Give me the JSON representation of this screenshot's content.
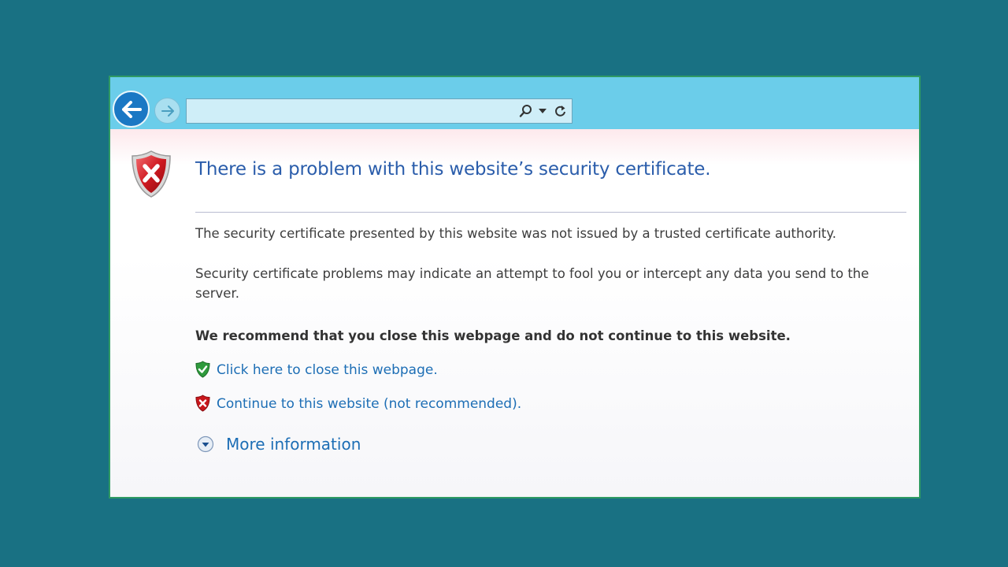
{
  "toolbar": {
    "back_icon": "back-arrow-icon",
    "forward_icon": "forward-arrow-icon",
    "address_value": "",
    "address_icons": [
      "search-icon",
      "dropdown-icon",
      "refresh-icon"
    ]
  },
  "page": {
    "title": "There is a problem with this website’s security certificate.",
    "paragraph_1": "The security certificate presented by this website was not issued by a trusted certificate authority.",
    "paragraph_2": "Security certificate problems may indicate an attempt to fool you or intercept any data you send to the server.",
    "recommendation": "We recommend that you close this webpage and do not continue to this website.",
    "close_link": "Click here to close this webpage.",
    "continue_link": "Continue to this website (not recommended).",
    "more_info": "More information"
  },
  "colors": {
    "background": "#197183",
    "toolbar": "#6bcdea",
    "title": "#2b5dab",
    "link": "#1d6eb5",
    "error_red": "#c8171c",
    "safe_green": "#2e9a3c"
  }
}
